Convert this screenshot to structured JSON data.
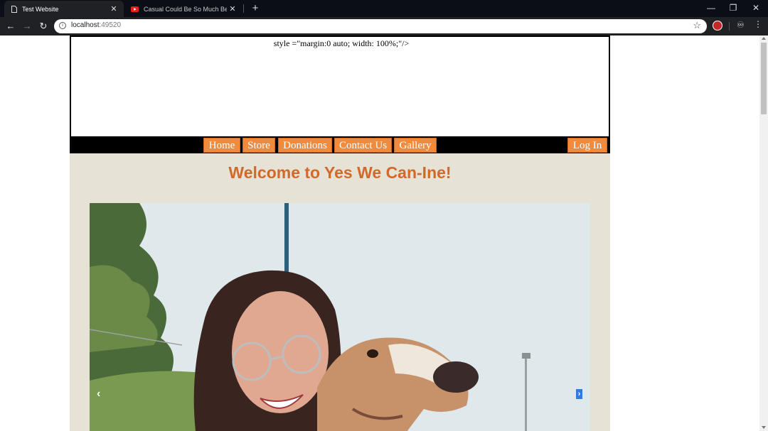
{
  "browser": {
    "tabs": [
      {
        "title": "Test Website",
        "active": true,
        "icon": "page-icon"
      },
      {
        "title": "Casual Could Be So Much Better",
        "active": false,
        "icon": "youtube-icon"
      }
    ],
    "url_host": "localhost",
    "url_port": ":49520"
  },
  "page": {
    "header_text": "style =\"margin:0 auto; width: 100%;\"/>",
    "nav": {
      "home": "Home",
      "store": "Store",
      "donations": "Donations",
      "contact": "Contact Us",
      "gallery": "Gallery",
      "login": "Log In"
    },
    "welcome": "Welcome to Yes We Can-Ine!",
    "colors": {
      "accent": "#f08a3c",
      "heading": "#d2692b",
      "content_bg": "#e6e2d6"
    }
  }
}
